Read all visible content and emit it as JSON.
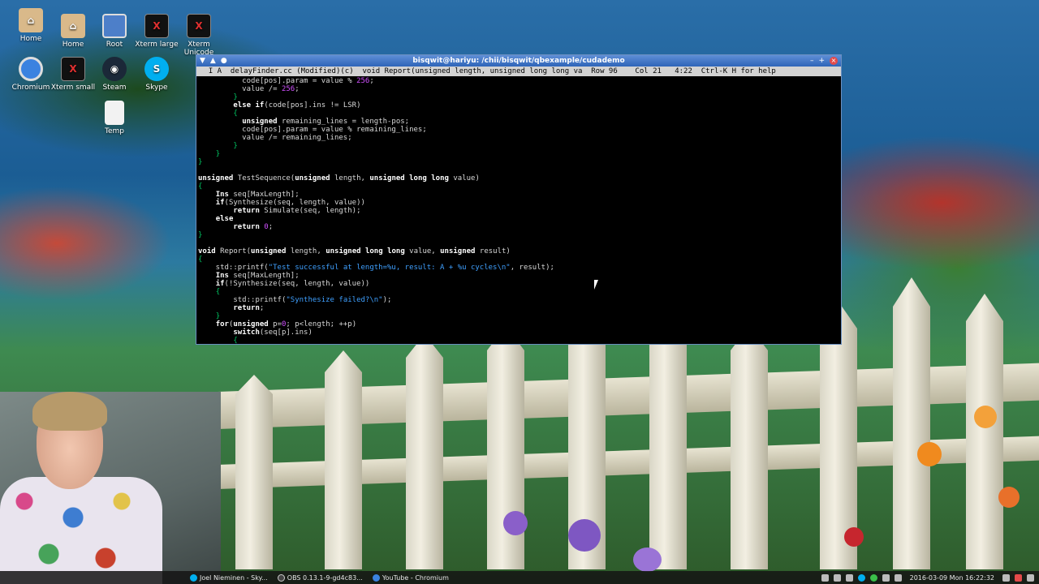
{
  "desktop": {
    "icons_row1": [
      {
        "label": "Home",
        "icon": "home-folder-icon"
      },
      {
        "label": "Home",
        "icon": "home-folder-icon"
      },
      {
        "label": "Root",
        "icon": "monitor-icon"
      },
      {
        "label": "Xterm large",
        "icon": "xterm-icon"
      },
      {
        "label": "Xterm Unicode",
        "icon": "xterm-icon"
      }
    ],
    "icons_row2": [
      {
        "label": "Chromium",
        "icon": "chromium-icon"
      },
      {
        "label": "Xterm small",
        "icon": "xterm-icon"
      },
      {
        "label": "Steam",
        "icon": "steam-icon"
      },
      {
        "label": "Skype",
        "icon": "skype-icon"
      }
    ],
    "icons_row3": [
      {
        "label": "Temp",
        "icon": "file-icon"
      }
    ]
  },
  "window": {
    "title": "bisqwit@hariyu: /chii/bisqwit/qbexample/cudademo",
    "status": "  I A  delayFinder.cc (Modified)(c)  void Report(unsigned length, unsigned long long va  Row 96    Col 21   4:22  Ctrl-K H for help"
  },
  "code": {
    "lines": [
      "          code[pos].param = value % 256;",
      "          value /= 256;",
      "        }",
      "        else if(code[pos].ins != LSR)",
      "        {",
      "          unsigned remaining_lines = length-pos;",
      "          code[pos].param = value % remaining_lines;",
      "          value /= remaining_lines;",
      "        }",
      "    }",
      "}",
      "",
      "unsigned TestSequence(unsigned length, unsigned long long value)",
      "{",
      "    Ins seq[MaxLength];",
      "    if(Synthesize(seq, length, value))",
      "        return Simulate(seq, length);",
      "    else",
      "        return 0;",
      "}",
      "",
      "void Report(unsigned length, unsigned long long value, unsigned result)",
      "{",
      "    std::printf(\"Test successful at length=%u, result: A + %u cycles\\n\", result);",
      "    Ins seq[MaxLength];",
      "    if(!Synthesize(seq, length, value))",
      "    {",
      "        std::printf(\"Synthesize failed?\\n\");",
      "        return;",
      "    }",
      "    for(unsigned p=0; p<length; ++p)",
      "        switch(seq[p].ins)",
      "        {"
    ]
  },
  "taskbar": {
    "tasks": [
      {
        "label": "Joel Nieminen - Sky...",
        "icon": "skype-icon"
      },
      {
        "label": "OBS 0.13.1-9-gd4c83...",
        "icon": "obs-icon"
      },
      {
        "label": "YouTube - Chromium",
        "icon": "chromium-icon"
      }
    ],
    "clock": "2016-03-09 Mon 16:22:32"
  },
  "colors": {
    "titlebar": "#2e64b9",
    "terminal_bg": "#000000",
    "string": "#3fa0ff",
    "number": "#d050ff",
    "brace": "#00c060"
  }
}
